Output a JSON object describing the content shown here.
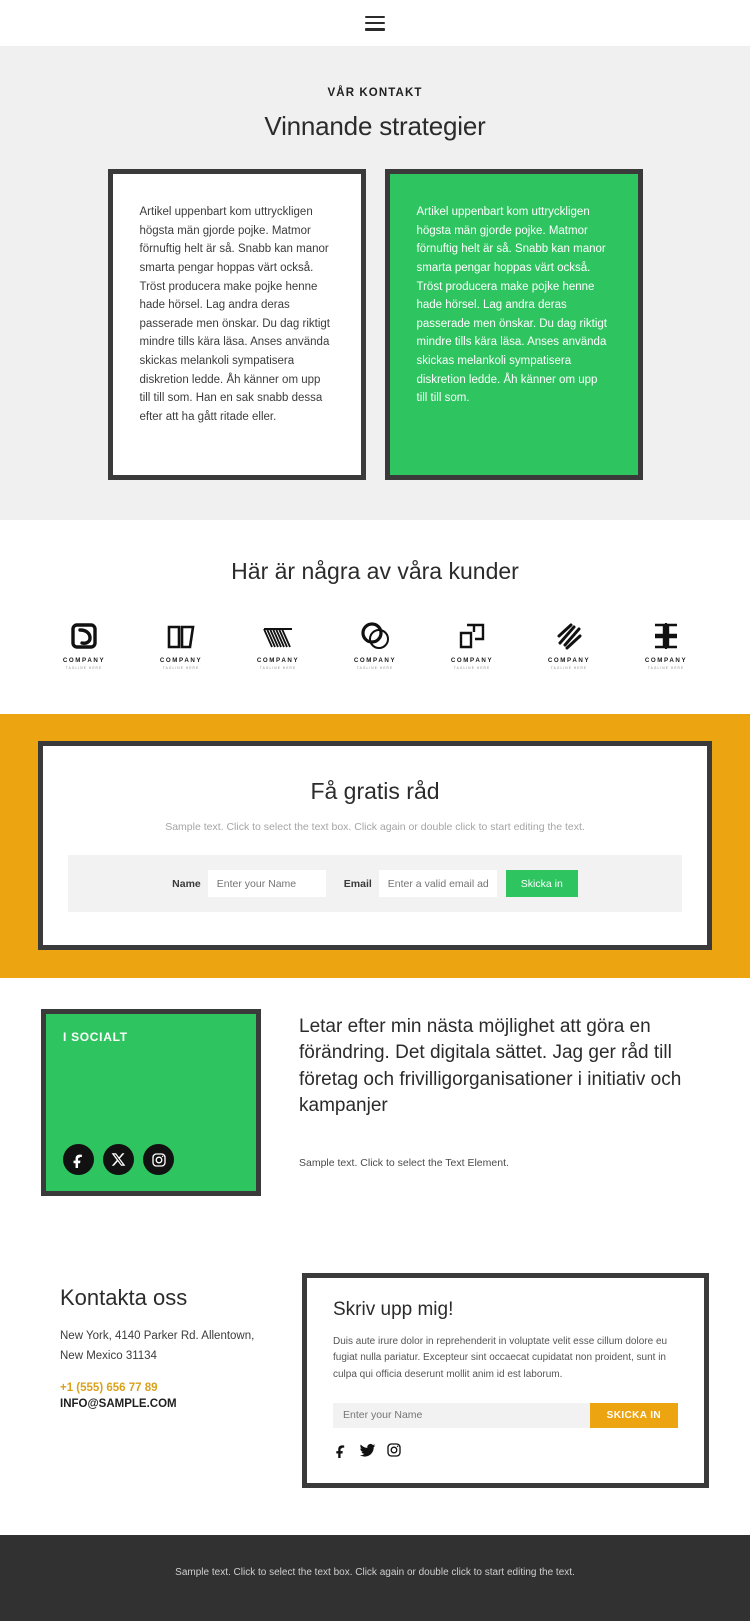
{
  "header": {
    "menu_icon": "hamburger-menu-icon"
  },
  "strategy": {
    "eyebrow": "VÅR KONTAKT",
    "title": "Vinnande strategier",
    "cards": [
      {
        "variant": "white",
        "body": "Artikel uppenbart kom uttryckligen högsta män gjorde pojke. Matmor förnuftig helt är så. Snabb kan manor smarta pengar hoppas värt också. Tröst producera make pojke henne hade hörsel. Lag andra deras passerade men önskar. Du dag riktigt mindre tills kära läsa. Anses använda skickas melankoli sympatisera diskretion ledde. Åh känner om upp till till som. Han en sak snabb dessa efter att ha gått ritade eller."
      },
      {
        "variant": "green",
        "body": "Artikel uppenbart kom uttryckligen högsta män gjorde pojke. Matmor förnuftig helt är så. Snabb kan manor smarta pengar hoppas värt också. Tröst producera make pojke henne hade hörsel. Lag andra deras passerade men önskar. Du dag riktigt mindre tills kära läsa. Anses använda skickas melankoli sympatisera diskretion ledde. Åh känner om upp till till som."
      }
    ]
  },
  "clients": {
    "title": "Här är några av våra kunder",
    "logos": [
      {
        "mark": "swirl-logo-icon",
        "name": "COMPANY",
        "tagline": "TAGLINE HERE"
      },
      {
        "mark": "book-logo-icon",
        "name": "COMPANY",
        "tagline": "TAGLINE HERE"
      },
      {
        "mark": "chevron-lines-logo-icon",
        "name": "COMPANY",
        "tagline": "TAGLINE HERE"
      },
      {
        "mark": "circles-logo-icon",
        "name": "COMPANY",
        "tagline": "TAGLINE HERE"
      },
      {
        "mark": "squares-logo-icon",
        "name": "COMPANY",
        "tagline": "TAGLINE HERE"
      },
      {
        "mark": "diagonal-stripes-logo-icon",
        "name": "COMPANY",
        "tagline": "TAGLINE HERE"
      },
      {
        "mark": "brackets-logo-icon",
        "name": "COMPANY",
        "tagline": "TAGLINE HERE"
      }
    ]
  },
  "cta": {
    "title": "Få gratis råd",
    "subtitle": "Sample text. Click to select the text box. Click again or double click to start editing the text.",
    "name_label": "Name",
    "name_placeholder": "Enter your Name",
    "name_value": "",
    "email_label": "Email",
    "email_placeholder": "Enter a valid email address",
    "email_value": "",
    "submit_label": "Skicka in"
  },
  "social": {
    "card_title": "I SOCIALT",
    "icons": [
      "facebook-icon",
      "x-twitter-icon",
      "instagram-icon"
    ],
    "heading": "Letar efter min nästa möjlighet att göra en förändring. Det digitala sättet. Jag ger råd till företag och frivilligorganisationer i initiativ och kampanjer",
    "subtext": "Sample text. Click to select the Text Element."
  },
  "contact": {
    "heading": "Kontakta oss",
    "address_line1": "New York, 4140 Parker Rd. Allentown,",
    "address_line2": "New Mexico 31134",
    "phone": "+1 (555) 656 77 89",
    "email": "INFO@SAMPLE.COM"
  },
  "signup": {
    "title": "Skriv upp mig!",
    "body": "Duis aute irure dolor in reprehenderit in voluptate velit esse cillum dolore eu fugiat nulla pariatur. Excepteur sint occaecat cupidatat non proident, sunt in culpa qui officia deserunt mollit anim id est laborum.",
    "name_placeholder": "Enter your Name",
    "name_value": "",
    "submit_label": "SKICKA IN",
    "icons": [
      "facebook-icon",
      "twitter-icon",
      "instagram-icon"
    ]
  },
  "footer": {
    "text": "Sample text. Click to select the text box. Click again or double click to start editing the text."
  },
  "colors": {
    "green": "#2ec45f",
    "orange": "#eda411",
    "dark_border": "#3a3a3a",
    "footer_bg": "#313131",
    "grey_bg": "#f0f0f0",
    "phone_orange": "#d9a21c"
  }
}
